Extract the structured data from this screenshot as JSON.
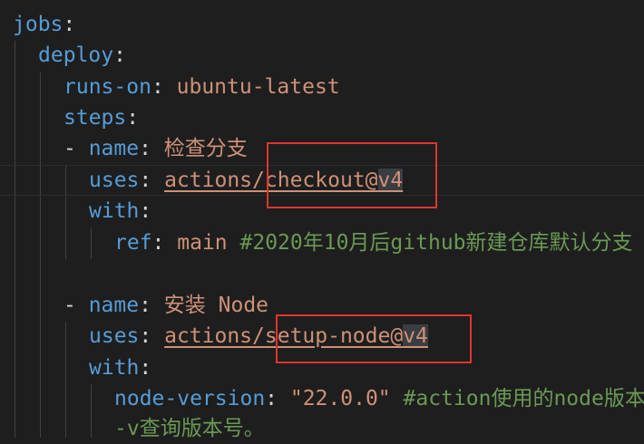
{
  "editor": {
    "lines": {
      "l1": {
        "key": "jobs",
        "colon": ":"
      },
      "l2": {
        "key": "deploy",
        "colon": ":"
      },
      "l3": {
        "key": "runs-on",
        "colon": ": ",
        "value": "ubuntu-latest"
      },
      "l4": {
        "key": "steps",
        "colon": ":"
      },
      "l5": {
        "dash": "- ",
        "key": "name",
        "colon": ": ",
        "value": "检查分支"
      },
      "l6": {
        "key": "uses",
        "colon": ": ",
        "value_pre": "actions/",
        "value_mid": "checkout@",
        "value_sel": "v4"
      },
      "l7": {
        "key": "with",
        "colon": ":"
      },
      "l8": {
        "key": "ref",
        "colon": ": ",
        "value": "main",
        "comment": "#2020年10月后github新建仓库默认分支"
      },
      "l10": {
        "dash": "- ",
        "key": "name",
        "colon": ": ",
        "value": "安装 Node"
      },
      "l11": {
        "key": "uses",
        "colon": ": ",
        "value_pre": "actions/",
        "value_mid": "setup-node@",
        "value_sel": "v4"
      },
      "l12": {
        "key": "with",
        "colon": ":"
      },
      "l13": {
        "key": "node-version",
        "colon": ": ",
        "value": "\"22.0.0\"",
        "comment": "#action使用的node版本"
      },
      "l14": {
        "comment": "-v查询版本号。"
      }
    }
  },
  "colors": {
    "background": "#1e1e1e",
    "key": "#569cd6",
    "string": "#ce9178",
    "comment": "#6a9955",
    "annotation_box": "#e0342f"
  }
}
